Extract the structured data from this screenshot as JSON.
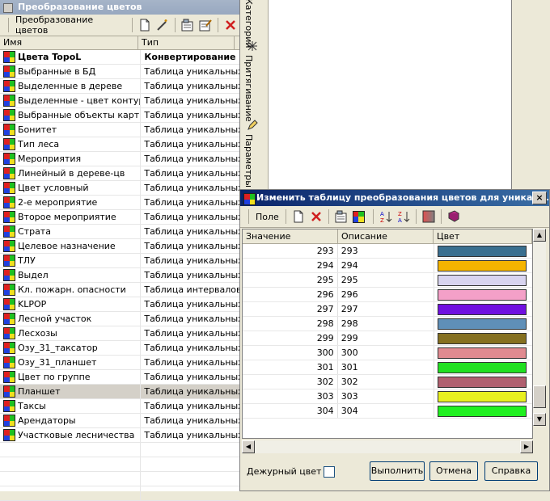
{
  "left_panel": {
    "title": "Преобразование цветов",
    "toolbar_label": "Преобразование цветов",
    "columns": [
      "Имя",
      "Тип"
    ],
    "rows": [
      {
        "name": "Цвета TopoL",
        "type": "Конвертирование в",
        "bold": true
      },
      {
        "name": "Выбранные в БД",
        "type": "Таблица уникальных з"
      },
      {
        "name": "Выделенные в дереве",
        "type": "Таблица уникальных з"
      },
      {
        "name": "Выделенные - цвет контура",
        "type": "Таблица уникальных з"
      },
      {
        "name": "Выбранные объекты карты",
        "type": "Таблица уникальных з"
      },
      {
        "name": "Бонитет",
        "type": "Таблица уникальных з"
      },
      {
        "name": "Тип леса",
        "type": "Таблица уникальных з"
      },
      {
        "name": "Мероприятия",
        "type": "Таблица уникальных з"
      },
      {
        "name": "Линейный в дереве-цв",
        "type": "Таблица уникальных з"
      },
      {
        "name": "Цвет условный",
        "type": "Таблица уникальных з"
      },
      {
        "name": "2-е мероприятие",
        "type": "Таблица уникальных з"
      },
      {
        "name": "Второе мероприятие",
        "type": "Таблица уникальных з"
      },
      {
        "name": "Страта",
        "type": "Таблица уникальных з"
      },
      {
        "name": "Целевое назначение",
        "type": "Таблица уникальных з"
      },
      {
        "name": "ТЛУ",
        "type": "Таблица уникальных з"
      },
      {
        "name": "Выдел",
        "type": "Таблица уникальных з"
      },
      {
        "name": "Кл. пожарн. опасности",
        "type": "Таблица интервалов"
      },
      {
        "name": "KLPOP",
        "type": "Таблица уникальных з"
      },
      {
        "name": "Лесной участок",
        "type": "Таблица уникальных з"
      },
      {
        "name": "Лесхозы",
        "type": "Таблица уникальных з"
      },
      {
        "name": "Озу_31_таксатор",
        "type": "Таблица уникальных з"
      },
      {
        "name": "Озу_31_планшет",
        "type": "Таблица уникальных з"
      },
      {
        "name": "Цвет по группе",
        "type": "Таблица уникальных з"
      },
      {
        "name": "Планшет",
        "type": "Таблица уникальных з",
        "selected": true
      },
      {
        "name": "Таксы",
        "type": "Таблица уникальных з"
      },
      {
        "name": "Арендаторы",
        "type": "Таблица уникальных з"
      },
      {
        "name": "Участковые лесничества",
        "type": "Таблица уникальных з"
      }
    ]
  },
  "side_tabs": [
    "Категории",
    "Притягивание",
    "Параметры"
  ],
  "dialog": {
    "title": "Изменить таблицу преобразования цветов для уникал...",
    "close": "×",
    "toolbar_label": "Поле",
    "columns": [
      "Значение",
      "Описание",
      "Цвет"
    ],
    "rows": [
      {
        "value": "293",
        "desc": "293",
        "color": "#3a6f8f"
      },
      {
        "value": "294",
        "desc": "294",
        "color": "#f5b400"
      },
      {
        "value": "295",
        "desc": "295",
        "color": "#d8d4f0"
      },
      {
        "value": "296",
        "desc": "296",
        "color": "#f4a0c8"
      },
      {
        "value": "297",
        "desc": "297",
        "color": "#7010e0"
      },
      {
        "value": "298",
        "desc": "298",
        "color": "#5f8fb8"
      },
      {
        "value": "299",
        "desc": "299",
        "color": "#857020"
      },
      {
        "value": "300",
        "desc": "300",
        "color": "#e08a90"
      },
      {
        "value": "301",
        "desc": "301",
        "color": "#20e020"
      },
      {
        "value": "302",
        "desc": "302",
        "color": "#b06070"
      },
      {
        "value": "303",
        "desc": "303",
        "color": "#e8f020"
      },
      {
        "value": "304",
        "desc": "304",
        "color": "#20f020"
      }
    ],
    "duty_color_label": "Дежурный цвет",
    "execute_label": "Выполнить",
    "cancel_label": "Отмена",
    "help_label": "Справка"
  }
}
